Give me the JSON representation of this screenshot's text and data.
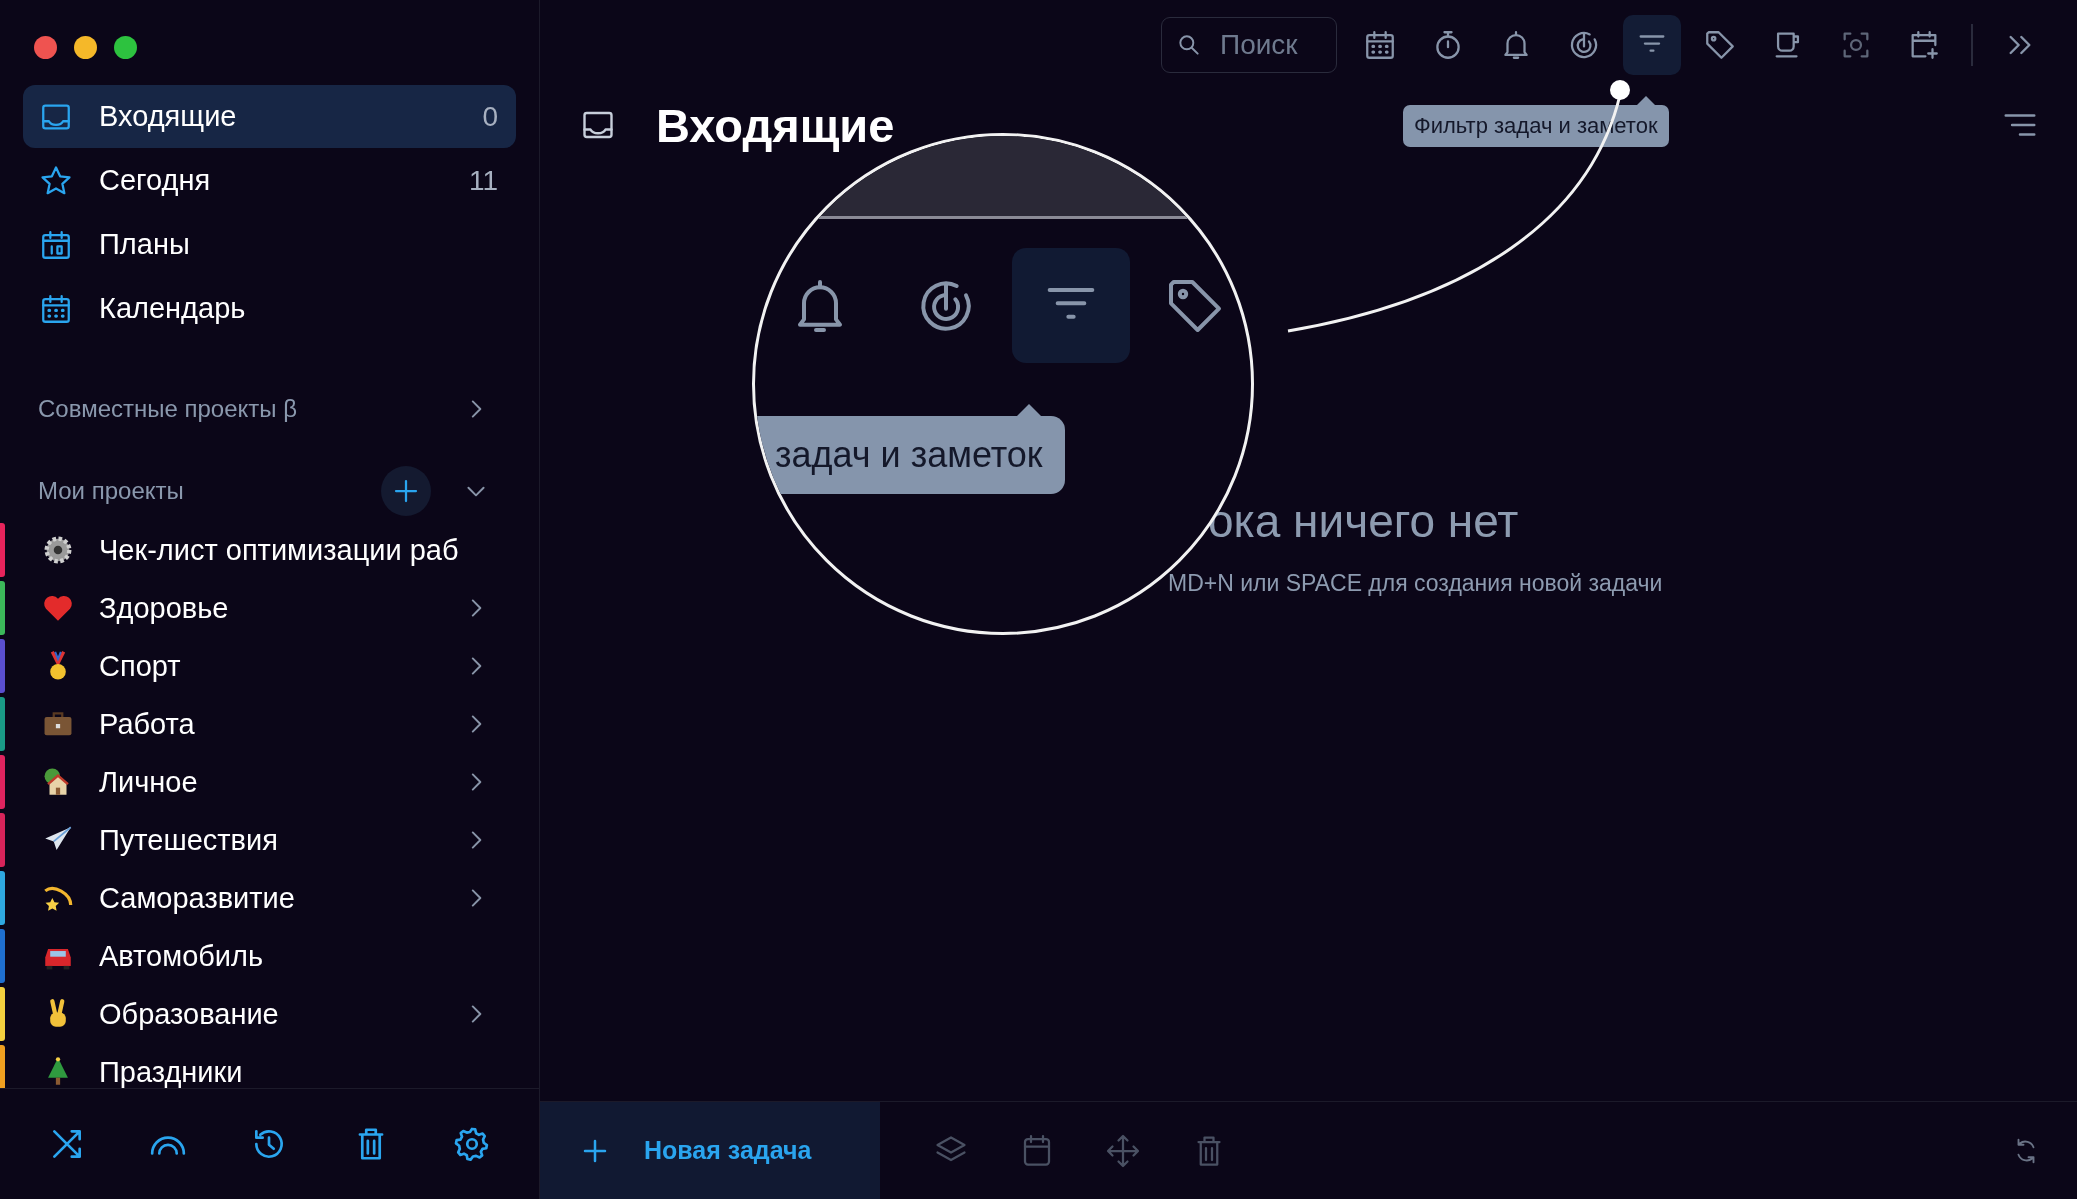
{
  "sidebar": {
    "nav": [
      {
        "kind": "inbox",
        "label": "Входящие",
        "count": "0",
        "selected": true
      },
      {
        "kind": "star",
        "label": "Сегодня",
        "count": "11",
        "selected": false
      },
      {
        "kind": "plans",
        "label": "Планы",
        "selected": false
      },
      {
        "kind": "calendar",
        "label": "Календарь",
        "selected": false
      }
    ],
    "shared_section": {
      "label": "Совместные проекты β"
    },
    "projects_section": {
      "label": "Мои проекты",
      "expanded": true
    },
    "projects": [
      {
        "kind": "gear",
        "name": "Чек-лист оптимизации раб",
        "color": "#e8245c",
        "expandable": false
      },
      {
        "kind": "heart",
        "name": "Здоровье",
        "color": "#3cb85a",
        "expandable": true
      },
      {
        "kind": "medal",
        "name": "Спорт",
        "color": "#5a4fcf",
        "expandable": true
      },
      {
        "kind": "briefcase",
        "name": "Работа",
        "color": "#1a9a86",
        "expandable": true
      },
      {
        "kind": "house",
        "name": "Личное",
        "color": "#e0245f",
        "expandable": true
      },
      {
        "kind": "plane",
        "name": "Путешествия",
        "color": "#d8245a",
        "expandable": true
      },
      {
        "kind": "comet",
        "name": "Саморазвитие",
        "color": "#2fa8e0",
        "expandable": true
      },
      {
        "kind": "car",
        "name": "Автомобиль",
        "color": "#1f6fd0",
        "expandable": false
      },
      {
        "kind": "hand",
        "name": "Образование",
        "color": "#f4d03f",
        "expandable": true
      },
      {
        "kind": "tree",
        "name": "Праздники",
        "color": "#f0a020",
        "expandable": false
      }
    ],
    "footer": [
      {
        "kind": "shuffle"
      },
      {
        "kind": "arc"
      },
      {
        "kind": "history"
      },
      {
        "kind": "trash"
      },
      {
        "kind": "gear"
      }
    ]
  },
  "toolbar": {
    "search": {
      "placeholder": "Поиск"
    },
    "buttons": [
      {
        "kind": "calendar",
        "selected": false
      },
      {
        "kind": "stopwatch",
        "selected": false
      },
      {
        "kind": "bell",
        "selected": false
      },
      {
        "kind": "target",
        "selected": false
      },
      {
        "kind": "filter",
        "selected": true
      },
      {
        "kind": "tag",
        "selected": false
      },
      {
        "kind": "cup",
        "selected": false
      },
      {
        "kind": "focus",
        "selected": false
      },
      {
        "kind": "calendar-plus",
        "selected": false
      }
    ],
    "more": {
      "kind": "double-chevron"
    }
  },
  "tooltip": {
    "text": "Фильтр задач и заметок"
  },
  "header": {
    "title": "Входящие"
  },
  "empty_state": {
    "title": "ока ничего нет",
    "hint": "MD+N или SPACE для создания новой задачи"
  },
  "magnifier": {
    "buttons": [
      {
        "kind": "bell",
        "selected": false
      },
      {
        "kind": "target",
        "selected": false
      },
      {
        "kind": "filter",
        "selected": true
      },
      {
        "kind": "tag",
        "selected": false
      }
    ],
    "tooltip": "задач и заметок"
  },
  "bottom_bar": {
    "new_task": "Новая задача",
    "actions": [
      {
        "kind": "layers"
      },
      {
        "kind": "calendar"
      },
      {
        "kind": "move"
      },
      {
        "kind": "trash"
      }
    ]
  }
}
